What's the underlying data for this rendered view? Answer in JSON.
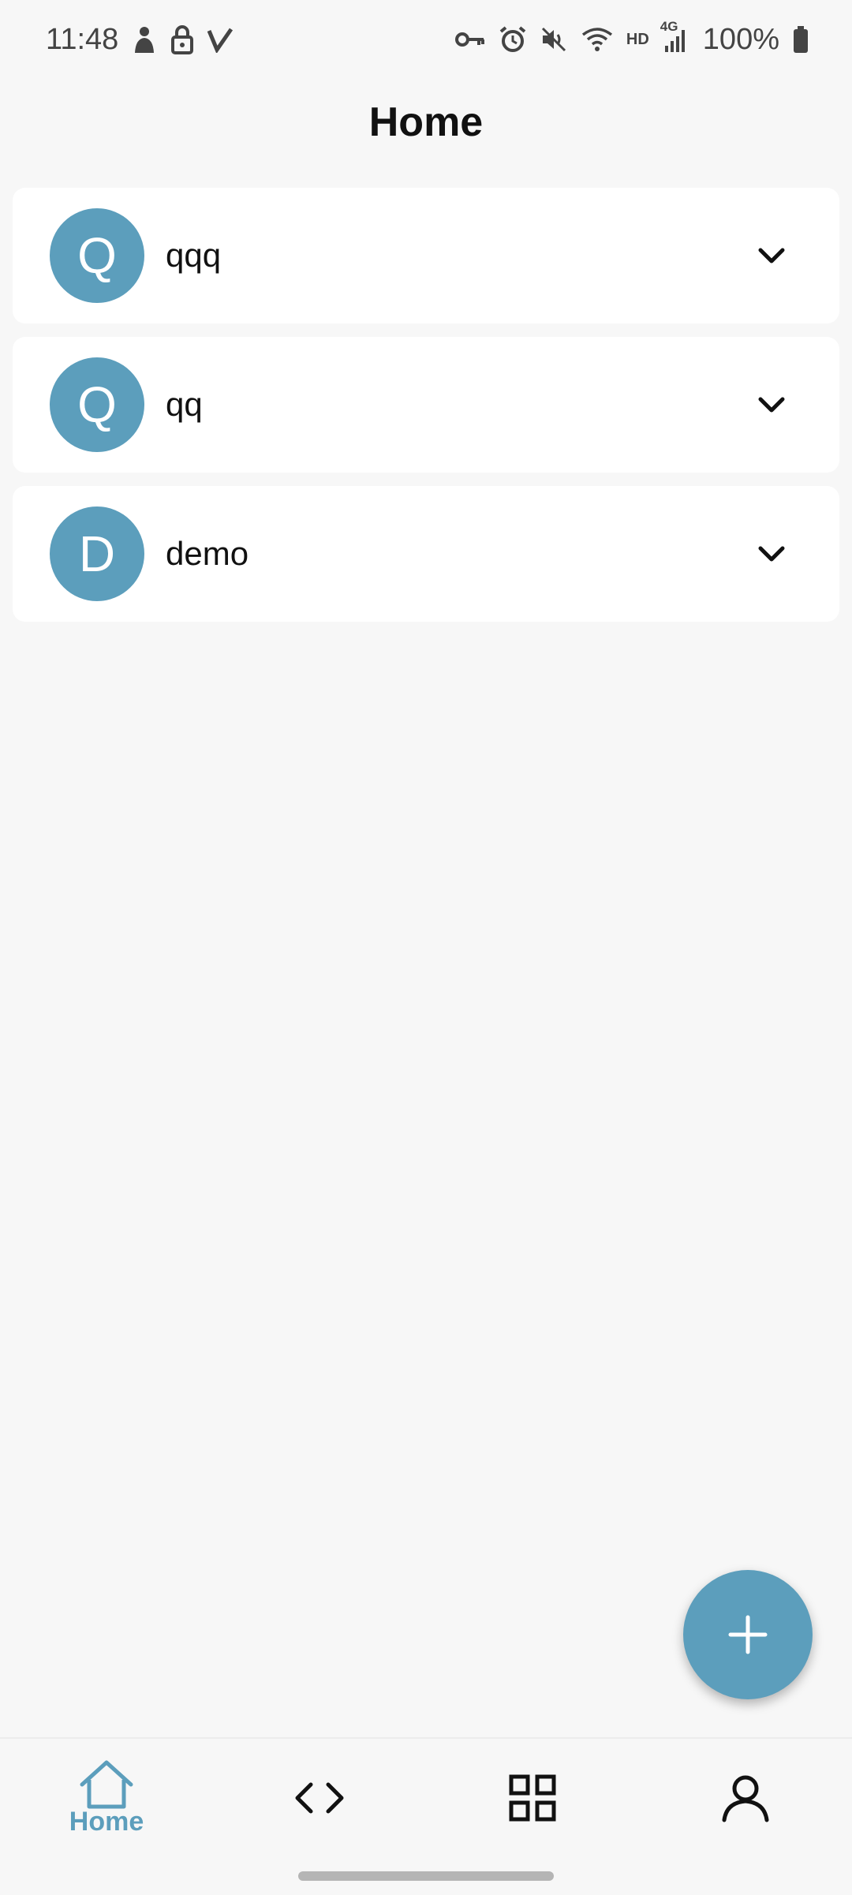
{
  "status_bar": {
    "time": "11:48",
    "battery": "100%",
    "network": "4G",
    "hd": "HD",
    "left_icons": [
      "silhouette-icon",
      "lock-icon",
      "v-icon"
    ],
    "right_icons": [
      "vpn-key-icon",
      "alarm-icon",
      "mute-icon",
      "wifi-icon",
      "hd-icon",
      "signal-icon",
      "battery-icon"
    ]
  },
  "header": {
    "title": "Home"
  },
  "list": {
    "items": [
      {
        "initial": "Q",
        "label": "qqq"
      },
      {
        "initial": "Q",
        "label": "qq"
      },
      {
        "initial": "D",
        "label": "demo"
      }
    ]
  },
  "fab": {
    "icon": "plus-icon"
  },
  "bottom_nav": {
    "items": [
      {
        "icon": "home-icon",
        "label": "Home",
        "active": true
      },
      {
        "icon": "code-icon"
      },
      {
        "icon": "grid-icon"
      },
      {
        "icon": "profile-icon"
      }
    ]
  },
  "colors": {
    "accent": "#5c9ebc",
    "background": "#f7f7f7",
    "card": "#ffffff"
  }
}
